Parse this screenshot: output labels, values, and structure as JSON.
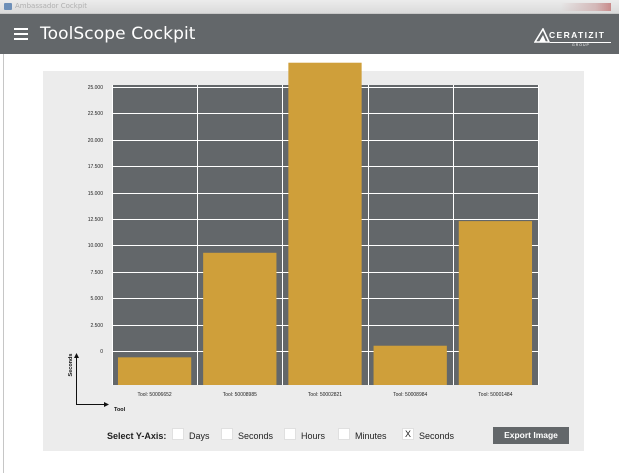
{
  "window": {
    "title": "Ambassador Cockpit"
  },
  "header": {
    "title": "ToolScope Cockpit",
    "brand": "CERATIZIT",
    "brand_sub": "GROUP"
  },
  "colors": {
    "header_bg": "#63676a",
    "plot_bg": "#63676a",
    "bar": "#cf9f3a",
    "panel_bg": "#ececec",
    "grid": "#ffffff"
  },
  "chart_data": {
    "type": "bar",
    "categories": [
      "Tool: 50006652",
      "Tool: 50008985",
      "Tool: 50002821",
      "Tool: 50008984",
      "Tool: 50001484"
    ],
    "values": [
      -600,
      9300,
      27300,
      500,
      12300
    ],
    "xlabel": "Tool",
    "ylabel": "Seconds",
    "yticks": [
      0,
      2500,
      5000,
      7500,
      10000,
      12500,
      15000,
      17500,
      20000,
      22500,
      25000
    ],
    "ytick_labels": [
      "0",
      "2.500",
      "5.000",
      "7.500",
      "10.000",
      "12.500",
      "15.000",
      "17.500",
      "20.000",
      "22.500",
      "25.000"
    ],
    "grid": true
  },
  "controls": {
    "label": "Select Y-Axis:",
    "options": [
      {
        "label": "Days",
        "mark": ""
      },
      {
        "label": "Seconds",
        "mark": ""
      },
      {
        "label": "Hours",
        "mark": ""
      },
      {
        "label": "Minutes",
        "mark": ""
      },
      {
        "label": "Seconds",
        "mark": "X"
      }
    ],
    "export_label": "Export Image"
  }
}
